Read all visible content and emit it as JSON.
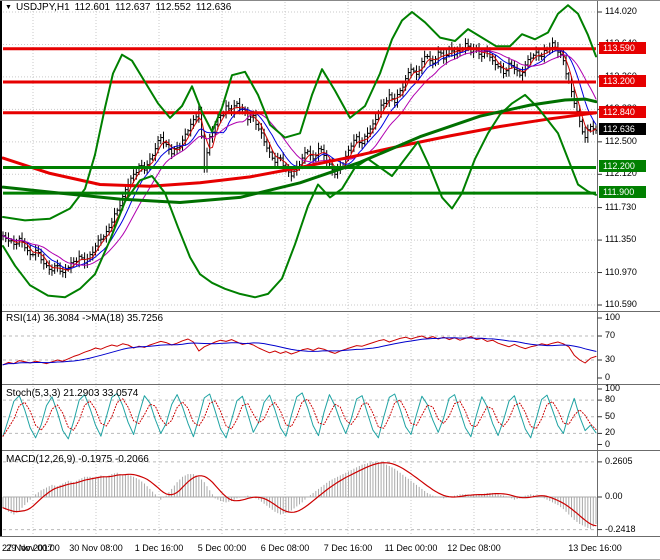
{
  "header": {
    "dropdown_icon": "▼",
    "symbol_period": "USDJPY,H1",
    "open": "112.601",
    "high": "112.637",
    "low": "112.552",
    "close": "112.636"
  },
  "colors": {
    "resistance": "#e60000",
    "support": "#008000",
    "current_bg": "#000000",
    "grid": "#c9c9c9",
    "level": "#b9b9b9",
    "bars": "#000000",
    "band": "#008000",
    "ma_slow_red": "#e60000",
    "ma_slow_green": "#007000",
    "ma_fast_red": "#d00000",
    "ma_fast_blue": "#0000e0",
    "ma_fast_violet": "#b000b0",
    "rsi_line": "#cc0000",
    "rsi_ma": "#0000cd",
    "stoch_main": "#1fa3a3",
    "stoch_signal": "#cc0000",
    "macd_hist": "#a9a9a9",
    "macd_signal": "#cc0000"
  },
  "price_scale": {
    "ticks": [
      "114.020",
      "113.640",
      "113.260",
      "112.880",
      "112.500",
      "112.120",
      "111.730",
      "111.350",
      "110.970",
      "110.590"
    ],
    "labels": [
      {
        "text": "113.590",
        "value": 113.59,
        "kind": "resistance"
      },
      {
        "text": "113.200",
        "value": 113.2,
        "kind": "resistance"
      },
      {
        "text": "112.840",
        "value": 112.84,
        "kind": "resistance"
      },
      {
        "text": "112.636",
        "value": 112.636,
        "kind": "current"
      },
      {
        "text": "112.200",
        "value": 112.2,
        "kind": "support"
      },
      {
        "text": "111.900",
        "value": 111.9,
        "kind": "support"
      }
    ]
  },
  "time_axis": {
    "labels": [
      "27 Nov 2017",
      "29 Nov 00:00",
      "30 Nov 08:00",
      "1 Dec 16:00",
      "5 Dec 00:00",
      "6 Dec 08:00",
      "7 Dec 16:00",
      "11 Dec 00:00",
      "12 Dec 08:00",
      "13 Dec 16:00"
    ]
  },
  "chart_data": [
    {
      "type": "ohlc",
      "panel": "main",
      "symbol": "USDJPY",
      "timeframe": "H1",
      "ylim": [
        110.45,
        114.14
      ],
      "yticks": [
        114.02,
        113.64,
        113.26,
        112.88,
        112.5,
        112.12,
        111.73,
        111.35,
        110.97,
        110.59
      ],
      "last_price": 112.636,
      "hlines": [
        {
          "value": 113.59,
          "kind": "resistance"
        },
        {
          "value": 113.2,
          "kind": "resistance"
        },
        {
          "value": 112.84,
          "kind": "resistance"
        },
        {
          "value": 112.2,
          "kind": "support"
        },
        {
          "value": 111.9,
          "kind": "support"
        }
      ],
      "close_path": [
        111.4,
        111.34,
        111.3,
        111.37,
        111.26,
        111.18,
        111.23,
        111.12,
        111.05,
        110.99,
        111.05,
        110.97,
        111.03,
        111.1,
        111.16,
        111.08,
        111.18,
        111.28,
        111.36,
        111.45,
        111.56,
        111.7,
        111.86,
        112.0,
        112.12,
        112.22,
        112.17,
        112.3,
        112.42,
        112.55,
        112.47,
        112.36,
        112.43,
        112.52,
        112.63,
        112.76,
        112.88,
        112.2,
        112.56,
        112.7,
        112.81,
        112.92,
        112.85,
        112.95,
        112.88,
        112.76,
        112.81,
        112.65,
        112.5,
        112.38,
        112.26,
        112.31,
        112.18,
        112.1,
        112.21,
        112.31,
        112.39,
        112.3,
        112.42,
        112.34,
        112.24,
        112.12,
        112.21,
        112.33,
        112.45,
        112.56,
        112.48,
        112.6,
        112.71,
        112.85,
        112.95,
        113.05,
        112.96,
        113.1,
        113.24,
        113.35,
        113.29,
        113.44,
        113.5,
        113.42,
        113.55,
        113.47,
        113.6,
        113.52,
        113.58,
        113.65,
        113.55,
        113.6,
        113.5,
        113.56,
        113.45,
        113.38,
        113.3,
        113.42,
        113.35,
        113.28,
        113.4,
        113.48,
        113.55,
        113.5,
        113.58,
        113.66,
        113.55,
        113.45,
        113.2,
        112.95,
        112.74,
        112.55,
        112.68,
        112.636
      ],
      "bollinger_upper": [
        [
          3,
          111.62
        ],
        [
          25,
          111.58
        ],
        [
          50,
          111.6
        ],
        [
          70,
          111.72
        ],
        [
          85,
          111.95
        ],
        [
          95,
          112.35
        ],
        [
          105,
          112.9
        ],
        [
          113,
          113.3
        ],
        [
          122,
          113.52
        ],
        [
          132,
          113.45
        ],
        [
          145,
          113.2
        ],
        [
          158,
          112.95
        ],
        [
          170,
          112.78
        ],
        [
          182,
          112.92
        ],
        [
          192,
          113.15
        ],
        [
          202,
          112.85
        ],
        [
          212,
          112.62
        ],
        [
          222,
          112.9
        ],
        [
          232,
          113.28
        ],
        [
          245,
          113.32
        ],
        [
          258,
          113.05
        ],
        [
          270,
          112.7
        ],
        [
          285,
          112.55
        ],
        [
          300,
          112.6
        ],
        [
          312,
          113.05
        ],
        [
          322,
          113.35
        ],
        [
          335,
          113.1
        ],
        [
          350,
          112.78
        ],
        [
          365,
          112.92
        ],
        [
          380,
          113.3
        ],
        [
          392,
          113.7
        ],
        [
          402,
          113.92
        ],
        [
          412,
          114.02
        ],
        [
          425,
          113.9
        ],
        [
          440,
          113.72
        ],
        [
          455,
          113.68
        ],
        [
          468,
          113.82
        ],
        [
          482,
          113.72
        ],
        [
          496,
          113.62
        ],
        [
          510,
          113.62
        ],
        [
          522,
          113.76
        ],
        [
          535,
          113.7
        ],
        [
          548,
          113.78
        ],
        [
          558,
          114.0
        ],
        [
          568,
          114.1
        ],
        [
          578,
          114.0
        ],
        [
          588,
          113.75
        ],
        [
          596,
          113.5
        ]
      ],
      "bollinger_lower": [
        [
          3,
          111.28
        ],
        [
          15,
          111.05
        ],
        [
          30,
          110.82
        ],
        [
          48,
          110.7
        ],
        [
          65,
          110.68
        ],
        [
          80,
          110.78
        ],
        [
          95,
          110.95
        ],
        [
          110,
          111.35
        ],
        [
          125,
          111.8
        ],
        [
          140,
          112.05
        ],
        [
          152,
          112.1
        ],
        [
          165,
          111.9
        ],
        [
          178,
          111.5
        ],
        [
          190,
          111.15
        ],
        [
          200,
          110.95
        ],
        [
          212,
          110.85
        ],
        [
          225,
          110.78
        ],
        [
          240,
          110.72
        ],
        [
          255,
          110.68
        ],
        [
          268,
          110.72
        ],
        [
          282,
          110.9
        ],
        [
          295,
          111.3
        ],
        [
          308,
          111.75
        ],
        [
          318,
          112.0
        ],
        [
          330,
          111.85
        ],
        [
          342,
          111.95
        ],
        [
          355,
          112.2
        ],
        [
          368,
          112.3
        ],
        [
          380,
          112.2
        ],
        [
          392,
          112.1
        ],
        [
          405,
          112.3
        ],
        [
          418,
          112.5
        ],
        [
          430,
          112.2
        ],
        [
          442,
          111.85
        ],
        [
          452,
          111.72
        ],
        [
          462,
          111.9
        ],
        [
          475,
          112.3
        ],
        [
          488,
          112.6
        ],
        [
          500,
          112.82
        ],
        [
          512,
          112.95
        ],
        [
          525,
          113.05
        ],
        [
          538,
          112.9
        ],
        [
          548,
          112.75
        ],
        [
          558,
          112.6
        ],
        [
          568,
          112.3
        ],
        [
          578,
          112.0
        ],
        [
          588,
          111.92
        ],
        [
          596,
          111.88
        ]
      ],
      "ma_green": [
        [
          3,
          111.97
        ],
        [
          60,
          111.9
        ],
        [
          120,
          111.83
        ],
        [
          180,
          111.79
        ],
        [
          240,
          111.85
        ],
        [
          300,
          112.02
        ],
        [
          360,
          112.26
        ],
        [
          420,
          112.56
        ],
        [
          480,
          112.8
        ],
        [
          530,
          112.93
        ],
        [
          565,
          112.99
        ],
        [
          585,
          113.0
        ],
        [
          596,
          112.97
        ]
      ],
      "ma_red": [
        [
          3,
          112.31
        ],
        [
          50,
          112.13
        ],
        [
          100,
          112.0
        ],
        [
          150,
          111.98
        ],
        [
          200,
          112.02
        ],
        [
          250,
          112.09
        ],
        [
          300,
          112.2
        ],
        [
          350,
          112.32
        ],
        [
          400,
          112.45
        ],
        [
          450,
          112.57
        ],
        [
          500,
          112.68
        ],
        [
          550,
          112.77
        ],
        [
          596,
          112.84
        ]
      ]
    },
    {
      "type": "line",
      "panel": "rsi",
      "label": "RSI(14) 36.3084  ->MA(18) 35.7256",
      "ylim": [
        0,
        100
      ],
      "yticks": [
        100,
        70,
        30,
        0
      ],
      "levels": [
        70,
        30
      ],
      "values": [
        22,
        26,
        24,
        29,
        27,
        25,
        28,
        26,
        24,
        27,
        30,
        28,
        32,
        36,
        39,
        43,
        46,
        50,
        48,
        52,
        55,
        53,
        57,
        55,
        50,
        53,
        51,
        55,
        58,
        61,
        59,
        55,
        58,
        62,
        65,
        60,
        45,
        52,
        56,
        60,
        63,
        61,
        64,
        60,
        56,
        58,
        55,
        50,
        46,
        42,
        45,
        41,
        44,
        40,
        43,
        47,
        49,
        46,
        50,
        48,
        44,
        41,
        45,
        48,
        51,
        54,
        53,
        56,
        59,
        62,
        64,
        60,
        63,
        66,
        68,
        65,
        68,
        70,
        66,
        69,
        65,
        68,
        64,
        67,
        63,
        66,
        69,
        64,
        66,
        61,
        63,
        58,
        55,
        52,
        56,
        52,
        49,
        52,
        54,
        57,
        55,
        58,
        60,
        57,
        52,
        38,
        30,
        25,
        33,
        36
      ]
    },
    {
      "type": "line",
      "panel": "stochastic",
      "label": "Stoch(5,3,3) 21.2903 33.0574",
      "ylim": [
        0,
        100
      ],
      "yticks": [
        100,
        80,
        50,
        20,
        0
      ],
      "levels": [
        80,
        50,
        20
      ],
      "values": [
        15,
        45,
        78,
        88,
        62,
        30,
        12,
        35,
        70,
        86,
        58,
        25,
        10,
        42,
        80,
        90,
        65,
        35,
        15,
        50,
        85,
        92,
        70,
        40,
        18,
        55,
        88,
        75,
        45,
        20,
        38,
        72,
        90,
        68,
        38,
        14,
        48,
        84,
        91,
        60,
        28,
        12,
        44,
        79,
        87,
        55,
        22,
        40,
        76,
        89,
        62,
        30,
        15,
        52,
        86,
        93,
        66,
        34,
        16,
        58,
        90,
        70,
        42,
        20,
        46,
        82,
        88,
        56,
        26,
        12,
        50,
        85,
        91,
        64,
        32,
        18,
        54,
        87,
        72,
        44,
        22,
        48,
        83,
        90,
        60,
        30,
        14,
        52,
        86,
        68,
        38,
        16,
        44,
        78,
        88,
        58,
        28,
        12,
        46,
        81,
        89,
        62,
        34,
        20,
        55,
        83,
        50,
        25,
        35,
        21
      ]
    },
    {
      "type": "bar",
      "panel": "macd",
      "label": "MACD(12,26,9) -0.1975 -0.2066",
      "ylim": [
        -0.27,
        0.29
      ],
      "yticks": [
        "0.2605",
        "0.00",
        "-0.2418"
      ],
      "values": [
        -0.08,
        -0.11,
        -0.13,
        -0.1,
        -0.06,
        -0.02,
        0.02,
        0.05,
        0.07,
        0.09,
        0.08,
        0.1,
        0.12,
        0.11,
        0.13,
        0.15,
        0.15,
        0.14,
        0.16,
        0.15,
        0.17,
        0.18,
        0.16,
        0.17,
        0.15,
        0.13,
        0.1,
        0.06,
        0.02,
        -0.02,
        0.01,
        0.06,
        0.11,
        0.15,
        0.17,
        0.17,
        0.15,
        0.11,
        0.05,
        -0.01,
        -0.03,
        -0.04,
        -0.03,
        -0.01,
        0.0,
        0.01,
        0.0,
        -0.02,
        -0.05,
        -0.08,
        -0.11,
        -0.13,
        -0.12,
        -0.1,
        -0.07,
        -0.04,
        0.0,
        0.03,
        0.06,
        0.09,
        0.12,
        0.14,
        0.16,
        0.18,
        0.2,
        0.22,
        0.24,
        0.25,
        0.26,
        0.26,
        0.25,
        0.23,
        0.21,
        0.18,
        0.15,
        0.12,
        0.09,
        0.06,
        0.03,
        0.01,
        0.0,
        -0.01,
        0.0,
        0.01,
        0.02,
        0.02,
        0.01,
        0.02,
        0.02,
        0.03,
        0.03,
        0.02,
        0.01,
        0.0,
        -0.02,
        -0.01,
        0.01,
        0.02,
        0.01,
        0.0,
        -0.02,
        -0.04,
        -0.06,
        -0.09,
        -0.13,
        -0.17,
        -0.2,
        -0.22,
        -0.24,
        -0.2
      ]
    }
  ]
}
